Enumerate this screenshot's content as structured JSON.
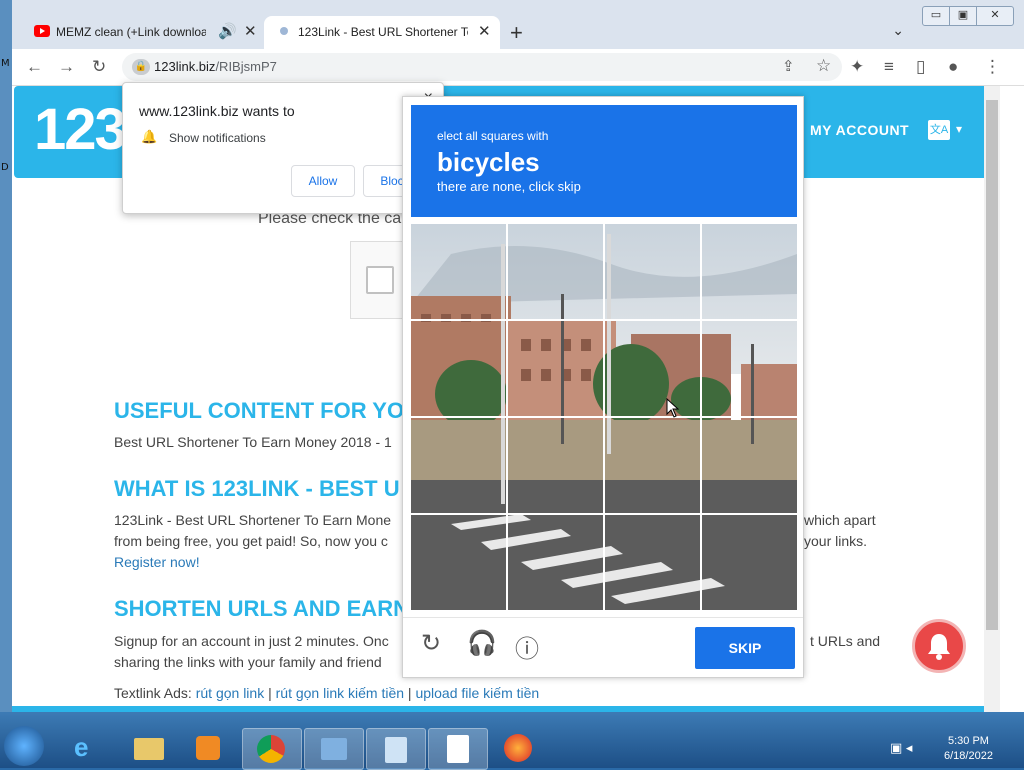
{
  "tabs": [
    {
      "title": "MEMZ clean (+Link download",
      "icon": "youtube-icon"
    },
    {
      "title": "123Link - Best URL Shortener To",
      "icon": "site-favicon"
    }
  ],
  "new_tab_symbol": "+",
  "window_controls": {
    "minimize": "▭",
    "restore": "▣",
    "close": "✕"
  },
  "address": {
    "domain": "123link.biz",
    "path": "/RIBjsmP7"
  },
  "site": {
    "logo_text": "123",
    "my_account": "MY ACCOUNT",
    "please_check": "Please check the ca",
    "sections": [
      {
        "heading": "USEFUL CONTENT FOR YO",
        "lines": [
          "Best URL Shortener To Earn Money 2018 - 1"
        ]
      },
      {
        "heading": "WHAT IS 123LINK - BEST U",
        "lines": [
          "123Link - Best URL Shortener To Earn Mone",
          "from being free, you get paid! So, now you c"
        ],
        "right_lines": [
          "which apart",
          "your links."
        ],
        "link": "Register now!"
      },
      {
        "heading": "SHORTEN URLS AND EARN",
        "lines": [
          "Signup for an account in just 2 minutes. Onc",
          "sharing the links with your family and friend"
        ],
        "right_lines": [
          "t URLs and",
          ""
        ]
      }
    ],
    "textlink_label": "Textlink Ads:",
    "textlinks": [
      "rút gọn link",
      "rút gọn link kiếm tiền",
      "upload file kiếm tiền"
    ],
    "textlink_sep": "|"
  },
  "permission_popup": {
    "title": "www.123link.biz wants to",
    "desc": "Show notifications",
    "allow": "Allow",
    "block": "Block",
    "close": "×"
  },
  "captcha": {
    "line1": "elect all squares with",
    "target": "bicycles",
    "line3": "there are none, click skip",
    "skip": "SKIP",
    "grid": [
      4,
      4
    ]
  },
  "taskbar": {
    "time": "5:30 PM",
    "date": "6/18/2022"
  },
  "colors": {
    "brand": "#2bb5e9",
    "captcha_blue": "#1a73e8",
    "notify_red": "#e94848"
  }
}
